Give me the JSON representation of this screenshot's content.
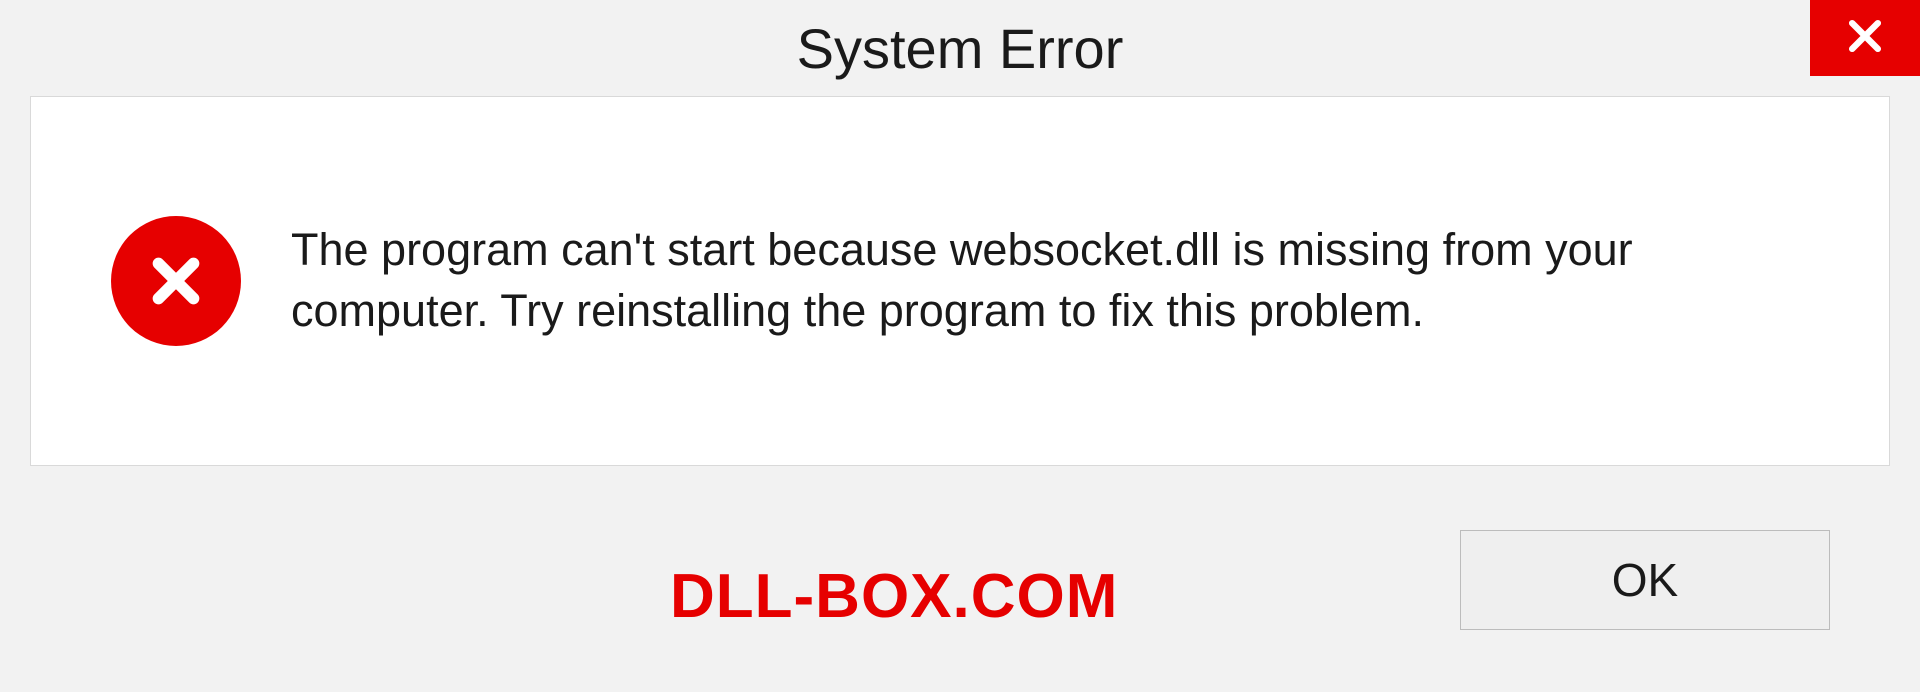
{
  "dialog": {
    "title": "System Error",
    "close_icon": "close-icon",
    "error_icon": "error-circle-x-icon",
    "message": "The program can't start because websocket.dll is missing from your computer. Try reinstalling the program to fix this problem.",
    "watermark": "DLL-BOX.COM",
    "ok_label": "OK"
  },
  "colors": {
    "accent_red": "#e60000",
    "bg_light": "#f2f2f2",
    "panel_white": "#ffffff",
    "border_gray": "#d9d9d9",
    "text_dark": "#1a1a1a"
  }
}
